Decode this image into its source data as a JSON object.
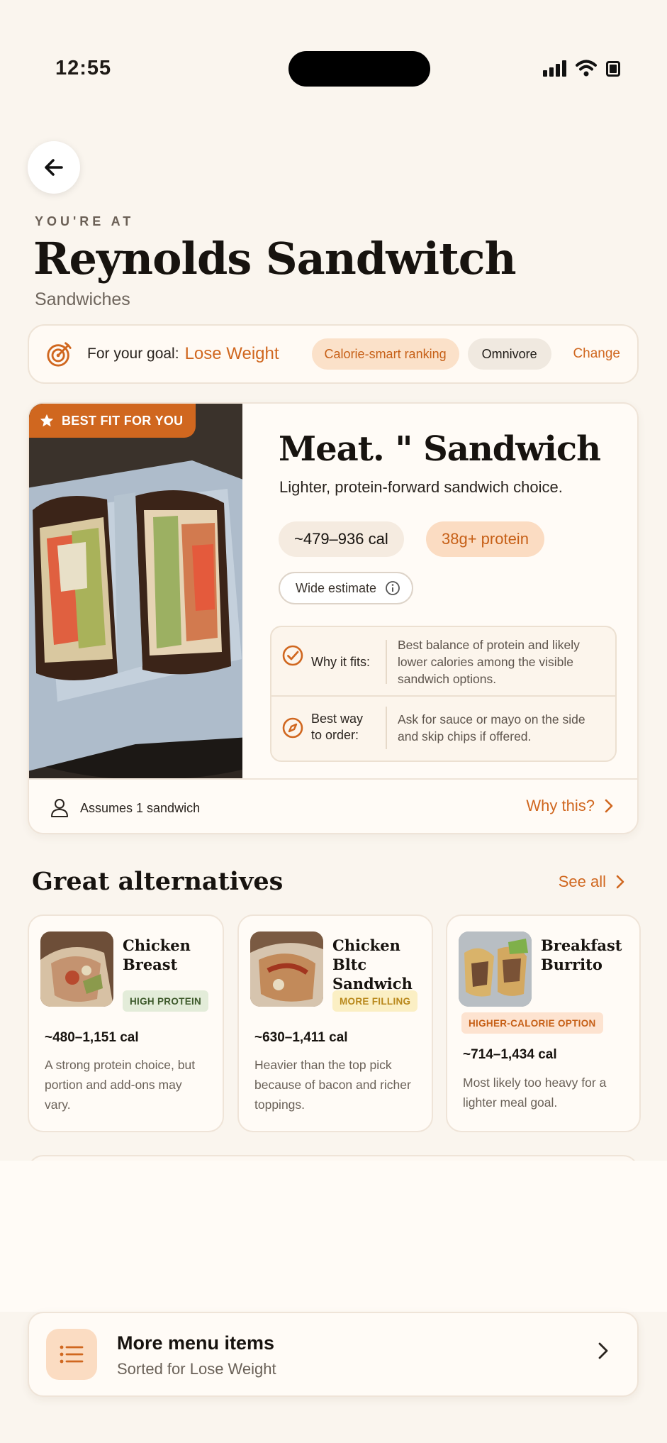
{
  "status_bar": {
    "time": "12:55"
  },
  "header": {
    "eyebrow": "YOU'RE AT",
    "restaurant_name": "Reynolds Sandwitch",
    "category": "Sandwiches"
  },
  "goal_bar": {
    "prefix": "For your goal:",
    "goal": "Lose Weight",
    "ranking_chip": "Calorie-smart ranking",
    "diet_chip": "Omnivore",
    "change_label": "Change"
  },
  "best_fit": {
    "badge": "BEST FIT FOR YOU",
    "title": "Meat. \" Sandwich",
    "description": "Lighter, protein-forward sandwich choice.",
    "calories": "~479–936 cal",
    "protein": "38g+ protein",
    "estimate_label": "Wide estimate",
    "why_fits_label": "Why it fits:",
    "why_fits_text": "Best balance of protein and likely lower calories among the visible sandwich options.",
    "order_label_line1": "Best way",
    "order_label_line2": "to order:",
    "order_text": "Ask for sauce or mayo on the side and skip chips if offered.",
    "assumes": "Assumes 1 sandwich",
    "why_this": "Why this?"
  },
  "alternatives": {
    "heading": "Great alternatives",
    "see_all": "See all",
    "items": [
      {
        "name_line1": "Chicken",
        "name_line2": "Breast",
        "tag": "HIGH PROTEIN",
        "calories": "~480–1,151 cal",
        "description": "A strong protein choice, but portion and add-ons may vary."
      },
      {
        "name_line1": "Chicken",
        "name_line2": "Bltc Sandwich",
        "tag": "MORE FILLING",
        "calories": "~630–1,411 cal",
        "description": "Heavier than the top pick because of bacon and richer toppings."
      },
      {
        "name_line1": "Breakfast",
        "name_line2": "Burrito",
        "tag": "HIGHER-CALORIE OPTION",
        "calories": "~714–1,434 cal",
        "description": "Most likely too heavy for a lighter meal goal."
      }
    ]
  },
  "more_menu": {
    "title": "More menu items",
    "subtitle": "Sorted for Lose Weight"
  },
  "colors": {
    "accent": "#d0671f",
    "background": "#faf5ee",
    "high_protein_tag": "#e3ecd9",
    "more_filling_tag": "#fbefc4",
    "higher_calorie_tag": "#fde3d0"
  }
}
